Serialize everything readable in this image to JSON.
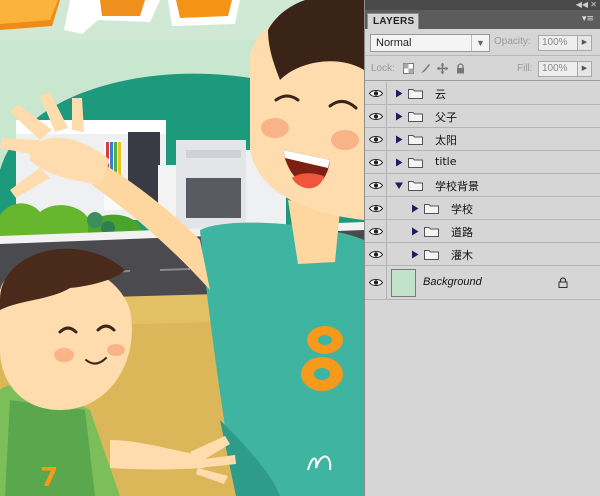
{
  "panel": {
    "tab_label": "LAYERS",
    "blend_mode": "Normal",
    "opacity_label": "Opacity:",
    "opacity_value": "100%",
    "lock_label": "Lock:",
    "fill_label": "Fill:",
    "fill_value": "100%"
  },
  "layers": [
    {
      "name": "云",
      "expanded": false,
      "indent": 0
    },
    {
      "name": "父子",
      "expanded": false,
      "indent": 0
    },
    {
      "name": "太阳",
      "expanded": false,
      "indent": 0
    },
    {
      "name": "title",
      "expanded": false,
      "indent": 0
    },
    {
      "name": "学校背景",
      "expanded": true,
      "indent": 0
    },
    {
      "name": "学校",
      "expanded": false,
      "indent": 1
    },
    {
      "name": "道路",
      "expanded": false,
      "indent": 1
    },
    {
      "name": "灌木",
      "expanded": false,
      "indent": 1
    }
  ],
  "background_layer": {
    "name": "Background",
    "locked": true,
    "thumb_color": "#c3e2cc"
  },
  "colors": {
    "panel_bg": "#d6d6d6",
    "canvas_bg": "#c9e7cf",
    "shirt_teal": "#3fb4a0",
    "number_orange": "#f59a1b",
    "skin": "#ffdcad"
  },
  "icons": [
    "eye-icon",
    "expand-triangle-icon",
    "folder-icon",
    "lock-icon",
    "panel-menu-icon",
    "collapse-icon",
    "close-icon"
  ]
}
